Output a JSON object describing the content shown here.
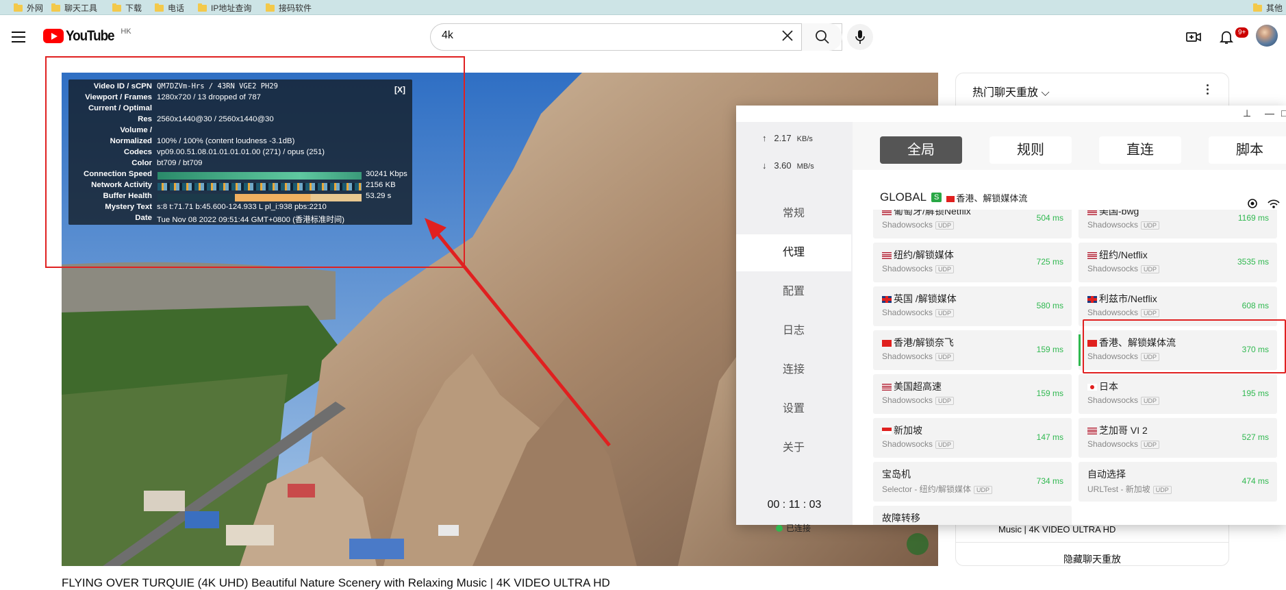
{
  "bookmarks": [
    "外网",
    "聊天工具",
    "下载",
    "电话",
    "IP地址查询",
    "接码软件",
    "其他"
  ],
  "youtube": {
    "logo_text": "YouTube",
    "region": "HK",
    "search_value": "4k",
    "notif_badge": "9+",
    "video_title": "FLYING OVER TURQUIE (4K UHD) Beautiful Nature Scenery with Relaxing Music | 4K VIDEO ULTRA HD"
  },
  "stats": {
    "close": "[X]",
    "rows": [
      {
        "label": "Video ID / sCPN",
        "value": "QM7DZVm-Hrs / 43RN VGE2 PH29"
      },
      {
        "label": "Viewport / Frames",
        "value": "1280x720 / 13 dropped of 787"
      },
      {
        "label": "Current / Optimal",
        "value": ""
      },
      {
        "label": "Res",
        "value": "2560x1440@30 / 2560x1440@30"
      },
      {
        "label": "Volume /",
        "value": ""
      },
      {
        "label": "Normalized",
        "value": "100% / 100% (content loudness -3.1dB)"
      },
      {
        "label": "Codecs",
        "value": "vp09.00.51.08.01.01.01.01.00 (271) / opus (251)"
      },
      {
        "label": "Color",
        "value": "bt709 / bt709"
      },
      {
        "label": "Connection Speed",
        "value": "30241 Kbps"
      },
      {
        "label": "Network Activity",
        "value": "2156 KB"
      },
      {
        "label": "Buffer Health",
        "value": "53.29 s"
      },
      {
        "label": "Mystery Text",
        "value": "s:8 t:71.71 b:45.600-124.933 L pl_i:938 pbs:2210"
      },
      {
        "label": "Date",
        "value": "Tue Nov 08 2022 09:51:44 GMT+0800 (香港标准时间)"
      }
    ]
  },
  "chat": {
    "title": "热门聊天重放",
    "subtitle_line": "Music | 4K VIDEO ULTRA HD",
    "hide_button": "隐藏聊天重放"
  },
  "clash": {
    "upload": {
      "arrow": "↑",
      "value": "2.17",
      "unit": "KB/s"
    },
    "download": {
      "arrow": "↓",
      "value": "3.60",
      "unit": "MB/s"
    },
    "nav": [
      "常规",
      "代理",
      "配置",
      "日志",
      "连接",
      "设置",
      "关于"
    ],
    "nav_selected": 1,
    "timer": "00 : 11 : 03",
    "status": "已连接",
    "modes": [
      "全局",
      "规则",
      "直连",
      "脚本"
    ],
    "mode_selected": 0,
    "group": {
      "name": "GLOBAL",
      "badge": "S",
      "selected": "香港、解锁媒体流"
    },
    "proxies_left": [
      {
        "name": "葡萄牙/解锁Netflix",
        "type": "Shadowsocks",
        "udp": "UDP",
        "latency": "504 ms",
        "flag": "us"
      },
      {
        "name": "纽约/解锁媒体",
        "type": "Shadowsocks",
        "udp": "UDP",
        "latency": "725 ms",
        "flag": "us"
      },
      {
        "name": "英国 /解锁媒体",
        "type": "Shadowsocks",
        "udp": "UDP",
        "latency": "580 ms",
        "flag": "uk"
      },
      {
        "name": "香港/解锁奈飞",
        "type": "Shadowsocks",
        "udp": "UDP",
        "latency": "159 ms",
        "flag": "hk"
      },
      {
        "name": "美国超高速",
        "type": "Shadowsocks",
        "udp": "UDP",
        "latency": "159 ms",
        "flag": "us"
      },
      {
        "name": "新加坡",
        "type": "Shadowsocks",
        "udp": "UDP",
        "latency": "147 ms",
        "flag": "sg"
      },
      {
        "name": "宝岛机",
        "type": "Selector - 纽约/解锁媒体",
        "udp": "UDP",
        "latency": "734 ms",
        "flag": ""
      },
      {
        "name": "故障转移",
        "type": "",
        "udp": "",
        "latency": "",
        "flag": ""
      }
    ],
    "proxies_right": [
      {
        "name": "美国-bwg",
        "type": "Shadowsocks",
        "udp": "UDP",
        "latency": "1169 ms",
        "flag": "us"
      },
      {
        "name": "纽约/Netflix",
        "type": "Shadowsocks",
        "udp": "UDP",
        "latency": "3535 ms",
        "flag": "us"
      },
      {
        "name": "利兹市/Netflix",
        "type": "Shadowsocks",
        "udp": "UDP",
        "latency": "608 ms",
        "flag": "uk"
      },
      {
        "name": "香港、解锁媒体流",
        "type": "Shadowsocks",
        "udp": "UDP",
        "latency": "370 ms",
        "flag": "hk",
        "selected": true
      },
      {
        "name": "日本",
        "type": "Shadowsocks",
        "udp": "UDP",
        "latency": "195 ms",
        "flag": "jp"
      },
      {
        "name": "芝加哥 VI 2",
        "type": "Shadowsocks",
        "udp": "UDP",
        "latency": "527 ms",
        "flag": "us"
      },
      {
        "name": "自动选择",
        "type": "URLTest - 新加坡",
        "udp": "UDP",
        "latency": "474 ms",
        "flag": ""
      }
    ]
  }
}
